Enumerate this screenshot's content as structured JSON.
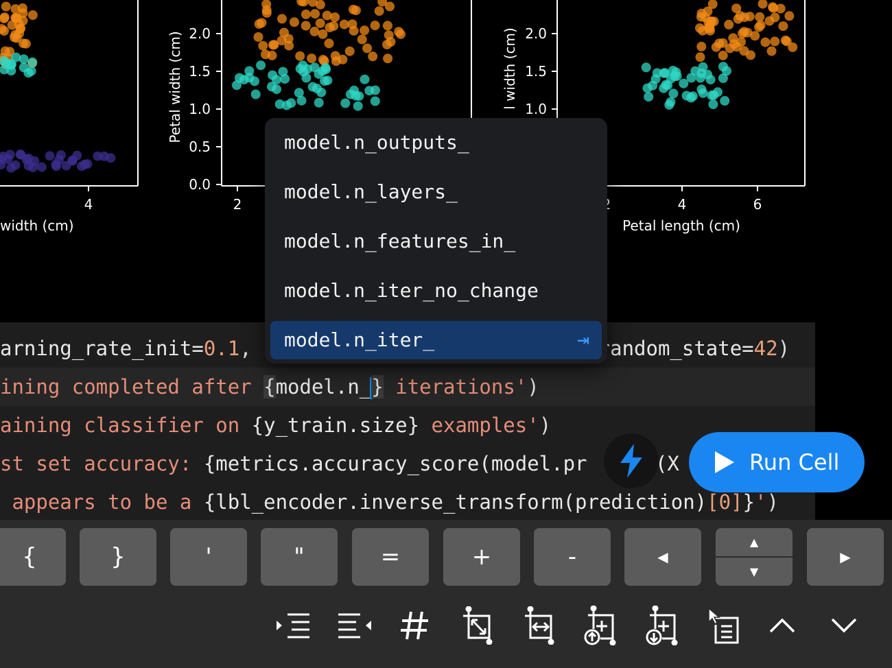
{
  "plots": {
    "panel2": {
      "ylabel": "Petal width (cm)",
      "yticks": [
        "0.0",
        "0.5",
        "1.0",
        "1.5",
        "2.0"
      ],
      "xticks": [
        "2"
      ]
    },
    "panel1": {
      "xlabel": "width (cm)",
      "xticks": [
        "4"
      ]
    },
    "panel3": {
      "ylabel": "l width (cm)",
      "yticks": [
        "1.0",
        "1.5",
        "2.0"
      ],
      "xticks": [
        "2",
        "4",
        "6"
      ],
      "xlabel": "Petal length (cm)"
    },
    "colors": {
      "setosa": "#3b2f8f",
      "versicolor": "#2fd8c4",
      "virginica": "#f08a17"
    }
  },
  "code": {
    "line1": {
      "a": "arning_rate_init=",
      "b": "0.1",
      "c": ",",
      "d": "random_state=",
      "e": "42",
      "f": ")"
    },
    "line2": {
      "a": "ining completed after ",
      "b": "{",
      "c": "model.n_",
      "d": "}",
      "e": " iterations'",
      "f": ")"
    },
    "line3": {
      "a": "aining classifier on ",
      "b": "{y_train.size}",
      "c": " examples'",
      "d": ")"
    },
    "line4": {
      "a": "st set accuracy: ",
      "b": "{metrics.accuracy_score(model.pr",
      "c": "t(X"
    },
    "line5": {
      "a": " appears to be a ",
      "b": "{lbl_encoder.inverse_transform(prediction)",
      "c": "[0]",
      "d": "}",
      "e": "'",
      "f": ")"
    }
  },
  "autocomplete": {
    "items": [
      "model.n_outputs_",
      "model.n_layers_",
      "model.n_features_in_",
      "model.n_iter_no_change",
      "model.n_iter_"
    ],
    "accept_glyph": "⇥"
  },
  "run": {
    "label": "Run Cell",
    "accent": "#1a86f2"
  },
  "keys": [
    "{",
    "}",
    "'",
    "\"",
    "=",
    "+",
    "-",
    "◀",
    "▲",
    "▼",
    "▶"
  ],
  "tools": [
    "indent",
    "dedent",
    "comment",
    "expand-cell",
    "fit-cell",
    "insert-above",
    "insert-below",
    "select-cell",
    "up",
    "down"
  ]
}
